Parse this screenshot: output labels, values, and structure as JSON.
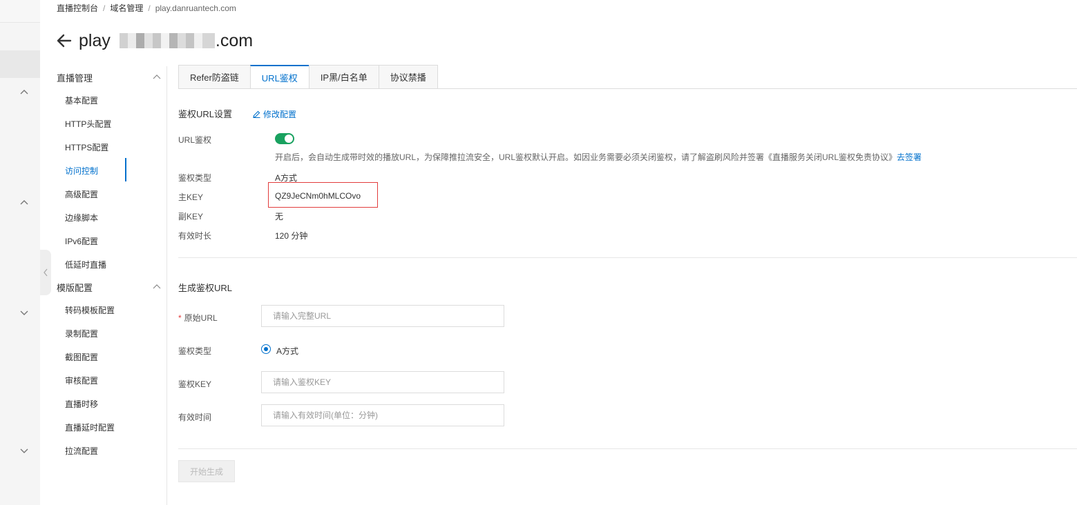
{
  "breadcrumb": {
    "items": [
      "直播控制台",
      "域名管理"
    ],
    "current": "play.danruantech.com"
  },
  "page": {
    "title_prefix": "play",
    "title_suffix": ".com"
  },
  "menu": {
    "group_live": "直播管理",
    "group_template": "模版配置",
    "items_live": [
      "基本配置",
      "HTTP头配置",
      "HTTPS配置",
      "访问控制",
      "高级配置",
      "边缘脚本",
      "IPv6配置",
      "低延时直播"
    ],
    "items_template": [
      "转码模板配置",
      "录制配置",
      "截图配置",
      "审核配置",
      "直播时移",
      "直播延时配置",
      "拉流配置"
    ]
  },
  "tabs": [
    "Refer防盗链",
    "URL鉴权",
    "IP黑/白名单",
    "协议禁播"
  ],
  "auth_settings": {
    "title": "鉴权URL设置",
    "edit_label": "修改配置",
    "url_auth_label": "URL鉴权",
    "url_auth_enabled": true,
    "description": "开启后，会自动生成带时效的播放URL，为保障推拉流安全，URL鉴权默认开启。如因业务需要必须关闭鉴权，请了解盗刷风险并签署《直播服务关闭URL鉴权免责协议》",
    "sign_link": "去签署",
    "type_label": "鉴权类型",
    "type_value": "A方式",
    "main_key_label": "主KEY",
    "main_key_value": "QZ9JeCNm0hMLCOvo",
    "sub_key_label": "副KEY",
    "sub_key_value": "无",
    "duration_label": "有效时长",
    "duration_value": "120 分钟"
  },
  "generate": {
    "title": "生成鉴权URL",
    "required_mark": "*",
    "origin_url_label": "原始URL",
    "origin_url_placeholder": "请输入完整URL",
    "type_label": "鉴权类型",
    "type_option": "A方式",
    "key_label": "鉴权KEY",
    "key_placeholder": "请输入鉴权KEY",
    "time_label": "有效时间",
    "time_placeholder": "请输入有效时间(单位：分钟)",
    "submit_label": "开始生成"
  },
  "colors": {
    "accent": "#0070cc",
    "switch_on": "#19a15f",
    "highlight_border": "#e23c3c"
  }
}
